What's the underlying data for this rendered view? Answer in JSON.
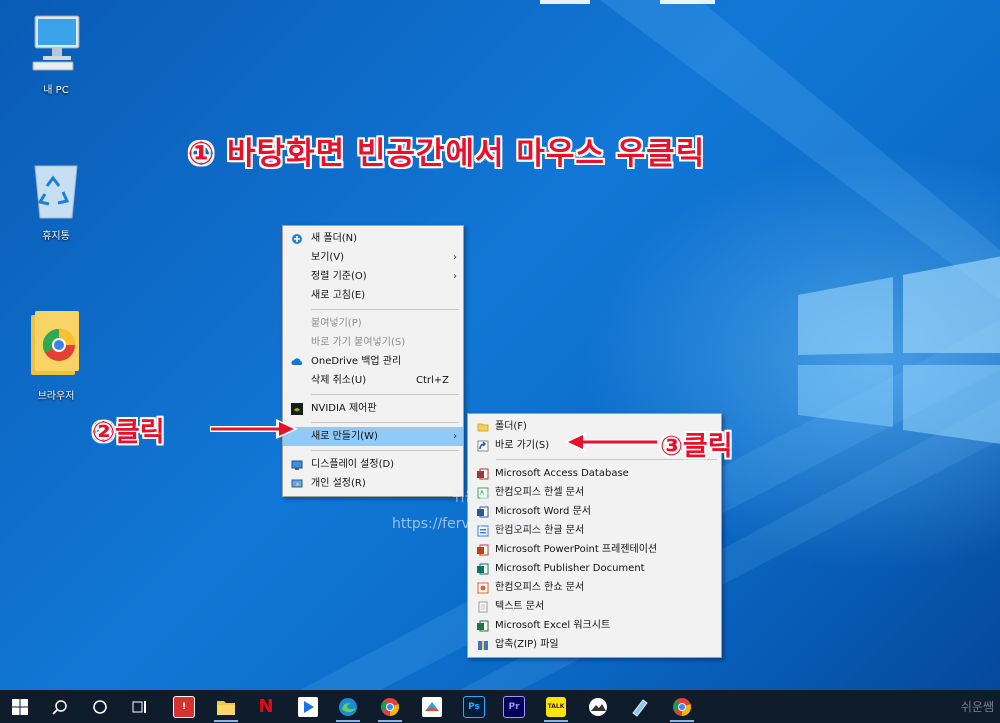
{
  "desktop": {
    "icons": [
      {
        "label": "내 PC"
      },
      {
        "label": "휴지통"
      },
      {
        "label": "브라우저"
      }
    ],
    "headline": "① 바탕화면 빈공간에서 마우스 우클릭",
    "callout_click2": "②클릭",
    "callout_click3": "③클릭",
    "watermark_name": "쉬운쌤",
    "watermark_url": "https://fervorstory.com",
    "corner_mark": "쉬운쌤"
  },
  "context_menu": {
    "items": [
      {
        "label": "새 폴더(N)",
        "icon": "new-folder-icon"
      },
      {
        "label": "보기(V)",
        "has_submenu": true
      },
      {
        "label": "정렬 기준(O)",
        "has_submenu": true
      },
      {
        "label": "새로 고침(E)"
      },
      {
        "label": "붙여넣기(P)",
        "disabled": true
      },
      {
        "label": "바로 가기 붙여넣기(S)",
        "disabled": true
      },
      {
        "label": "OneDrive 백업 관리",
        "icon": "onedrive-icon"
      },
      {
        "label": "삭제 취소(U)",
        "shortcut": "Ctrl+Z"
      },
      {
        "label": "NVIDIA 제어판",
        "icon": "nvidia-icon"
      },
      {
        "label": "새로 만들기(W)",
        "has_submenu": true,
        "highlighted": true
      },
      {
        "label": "디스플레이 설정(D)",
        "icon": "display-icon"
      },
      {
        "label": "개인 설정(R)",
        "icon": "personalize-icon"
      }
    ]
  },
  "new_submenu": {
    "items": [
      {
        "label": "폴더(F)",
        "icon": "folder-icon"
      },
      {
        "label": "바로 가기(S)",
        "icon": "shortcut-icon"
      },
      {
        "label": "Microsoft Access Database",
        "icon": "access-icon"
      },
      {
        "label": "한컴오피스 한셀 문서",
        "icon": "hancell-icon"
      },
      {
        "label": "Microsoft Word 문서",
        "icon": "word-icon"
      },
      {
        "label": "한컴오피스 한글 문서",
        "icon": "hwp-icon"
      },
      {
        "label": "Microsoft PowerPoint 프레젠테이션",
        "icon": "powerpoint-icon"
      },
      {
        "label": "Microsoft Publisher Document",
        "icon": "publisher-icon"
      },
      {
        "label": "한컴오피스 한쇼 문서",
        "icon": "hanshow-icon"
      },
      {
        "label": "텍스트 문서",
        "icon": "text-doc-icon"
      },
      {
        "label": "Microsoft Excel 워크시트",
        "icon": "excel-icon"
      },
      {
        "label": "압축(ZIP) 파일",
        "icon": "zip-icon"
      }
    ]
  },
  "taskbar": {
    "pinned": [
      "start-icon",
      "search-icon",
      "cortana-icon",
      "task-view-icon",
      "app-red-icon",
      "file-explorer-icon",
      "netflix-icon",
      "play-store-icon",
      "edge-icon",
      "chrome-icon",
      "app-color-icon",
      "photoshop-icon",
      "premiere-icon",
      "kakaotalk-icon",
      "app-mountain-icon",
      "app-pen-icon",
      "chrome-2-icon"
    ],
    "labels": {
      "photoshop": "Ps",
      "premiere": "Pr",
      "kakaotalk": "TALK",
      "netflix": "N"
    }
  }
}
